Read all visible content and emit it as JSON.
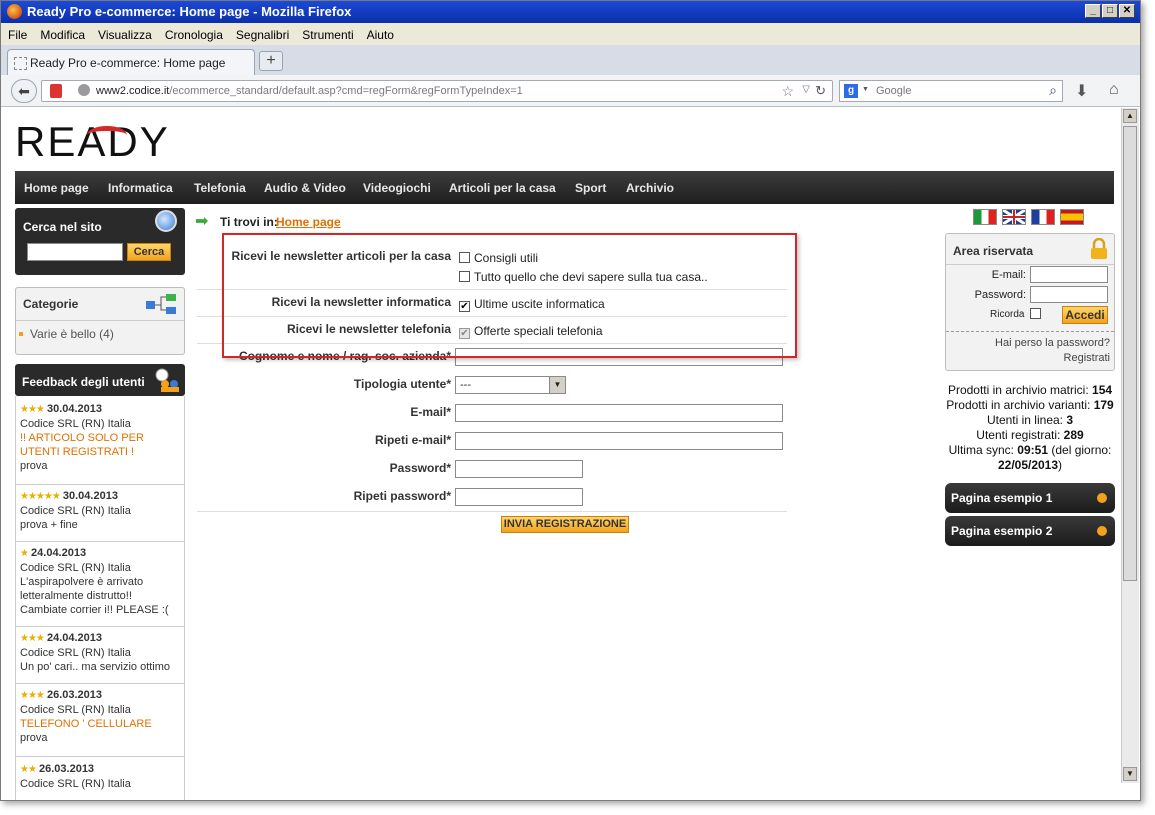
{
  "window": {
    "title": "Ready Pro e-commerce: Home page - Mozilla Firefox"
  },
  "menubar": [
    "File",
    "Modifica",
    "Visualizza",
    "Cronologia",
    "Segnalibri",
    "Strumenti",
    "Aiuto"
  ],
  "tab": {
    "label": "Ready Pro e-commerce: Home page"
  },
  "url": {
    "domain": "www2.codice.it",
    "path": "/ecommerce_standard/default.asp?cmd=regForm&regFormTypeIndex=1"
  },
  "search": {
    "placeholder": "Google"
  },
  "logo": "READY",
  "nav": [
    "Home page",
    "Informatica",
    "Telefonia",
    "Audio & Video",
    "Videogiochi",
    "Articoli per la casa",
    "Sport",
    "Archivio"
  ],
  "sidebar": {
    "search_title": "Cerca nel sito",
    "search_button": "Cerca",
    "categories_title": "Categorie",
    "category_item": "Varie è bello (4)",
    "feedback_title": "Feedback degli utenti",
    "feedback": [
      {
        "stars": "★★★",
        "date": "30.04.2013",
        "author": "Codice SRL (RN) Italia",
        "text": "!! ARTICOLO SOLO PER UTENTI REGISTRATI !",
        "text2": "prova"
      },
      {
        "stars": "★★★★★",
        "date": "30.04.2013",
        "author": "Codice SRL (RN) Italia",
        "text": "",
        "text2": "prova + fine"
      },
      {
        "stars": "★",
        "date": "24.04.2013",
        "author": "Codice SRL (RN) Italia",
        "text": "",
        "text2": "L'aspirapolvere è arrivato letteralmente distrutto!! Cambiate corrier i!! PLEASE :("
      },
      {
        "stars": "★★★",
        "date": "24.04.2013",
        "author": "Codice SRL (RN) Italia",
        "text": "",
        "text2": "Un po' cari.. ma servizio ottimo"
      },
      {
        "stars": "★★★",
        "date": "26.03.2013",
        "author": "Codice SRL (RN) Italia",
        "text": "TELEFONO ' CELLULARE",
        "text2": "prova"
      },
      {
        "stars": "★★",
        "date": "26.03.2013",
        "author": "Codice SRL (RN) Italia",
        "text": "",
        "text2": ""
      }
    ]
  },
  "breadcrumb": {
    "prefix": "Ti trovi in:",
    "link": "Home page"
  },
  "form": {
    "nl_casa_label": "Ricevi le newsletter articoli per la casa",
    "nl_casa_opt1": "Consigli utili",
    "nl_casa_opt2": "Tutto quello che devi sapere sulla tua casa..",
    "nl_info_label": "Ricevi la newsletter informatica",
    "nl_info_opt": "Ultime uscite informatica",
    "nl_tel_label": "Ricevi le newsletter telefonia",
    "nl_tel_opt": "Offerte speciali telefonia",
    "name_label": "Cognome e nome / rag. soc. azienda*",
    "type_label": "Tipologia utente*",
    "type_value": "---",
    "email_label": "E-mail*",
    "email2_label": "Ripeti e-mail*",
    "pwd_label": "Password*",
    "pwd2_label": "Ripeti password*",
    "submit": "INVIA REGISTRAZIONE"
  },
  "login": {
    "title": "Area riservata",
    "email_label": "E-mail:",
    "pwd_label": "Password:",
    "remember": "Ricorda",
    "button": "Accedi",
    "forgot": "Hai perso la password?",
    "register": "Registrati"
  },
  "stats": {
    "matrici_label": "Prodotti in archivio matrici:",
    "matrici": "154",
    "varianti_label": "Prodotti in archivio varianti:",
    "varianti": "179",
    "online_label": "Utenti in linea:",
    "online": "3",
    "registered_label": "Utenti registrati:",
    "registered": "289",
    "sync_label": "Ultima sync:",
    "sync_time": "09:51",
    "sync_mid": "(del giorno:",
    "sync_date": "22/05/2013",
    ")": ")"
  },
  "pages": [
    "Pagina esempio 1",
    "Pagina esempio 2"
  ]
}
